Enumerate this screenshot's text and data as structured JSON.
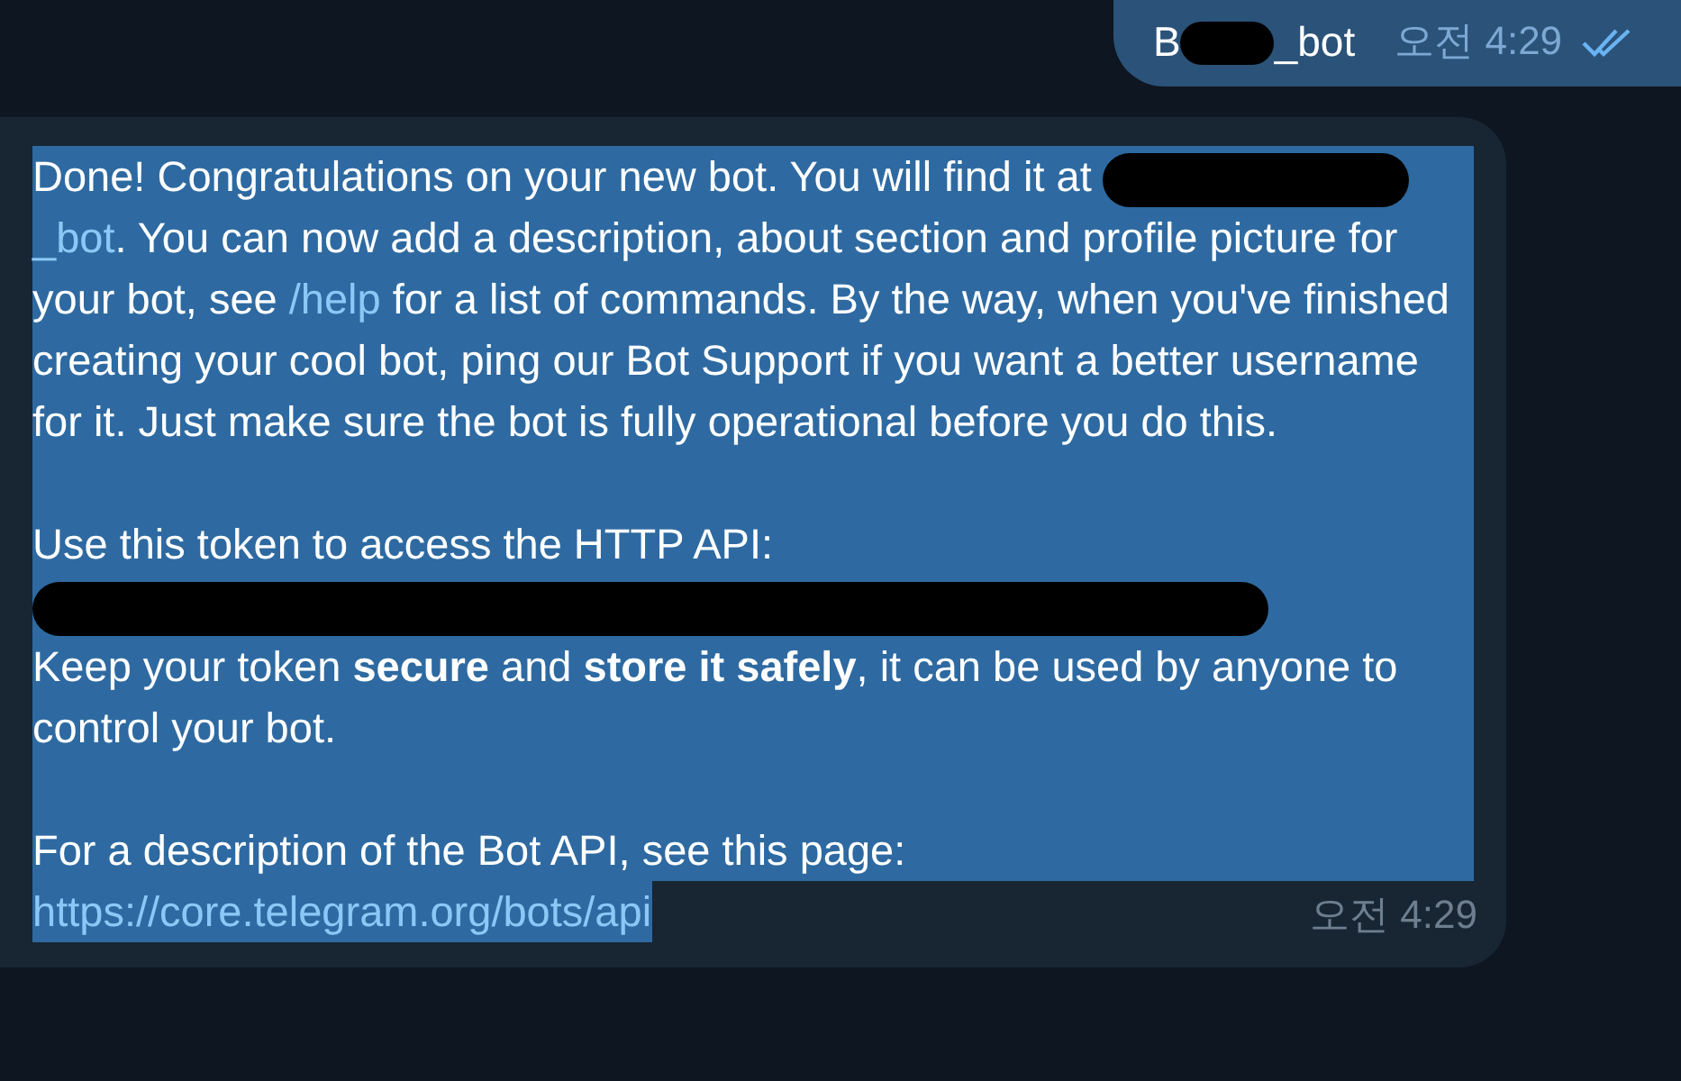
{
  "outgoing_message": {
    "segments": [
      {
        "kind": "text",
        "text": "B"
      },
      {
        "kind": "redacted"
      },
      {
        "kind": "text",
        "text": "_bot"
      }
    ],
    "time": "오전 4:29",
    "read": true
  },
  "incoming_message": {
    "selected": true,
    "paragraphs": [
      {
        "segments": [
          {
            "kind": "text",
            "text": "Done! Congratulations on your new bot. You will find it at "
          },
          {
            "kind": "redacted"
          },
          {
            "kind": "link",
            "text": "_bot"
          },
          {
            "kind": "text",
            "text": ". You can now add a description, about section and profile picture for your bot, see "
          },
          {
            "kind": "link",
            "text": "/help"
          },
          {
            "kind": "text",
            "text": " for a list of commands. By the way, when you've finished creating your cool bot, ping our Bot Support if you want a better username for it. Just make sure the bot is fully operational before you do this."
          }
        ]
      },
      {
        "segments": [
          {
            "kind": "text",
            "text": "Use this token to access the HTTP API:"
          },
          {
            "kind": "redacted_line"
          },
          {
            "kind": "text",
            "text": "Keep your token "
          },
          {
            "kind": "bold",
            "text": "secure"
          },
          {
            "kind": "text",
            "text": " and "
          },
          {
            "kind": "bold",
            "text": "store it safely"
          },
          {
            "kind": "text",
            "text": ", it can be used by anyone to control your bot."
          }
        ]
      },
      {
        "segments": [
          {
            "kind": "text",
            "text": "For a description of the Bot API, see this page:"
          },
          {
            "kind": "break"
          },
          {
            "kind": "link",
            "text": "https://core.telegram.org/bots/api"
          }
        ]
      }
    ],
    "time": "오전 4:29"
  }
}
